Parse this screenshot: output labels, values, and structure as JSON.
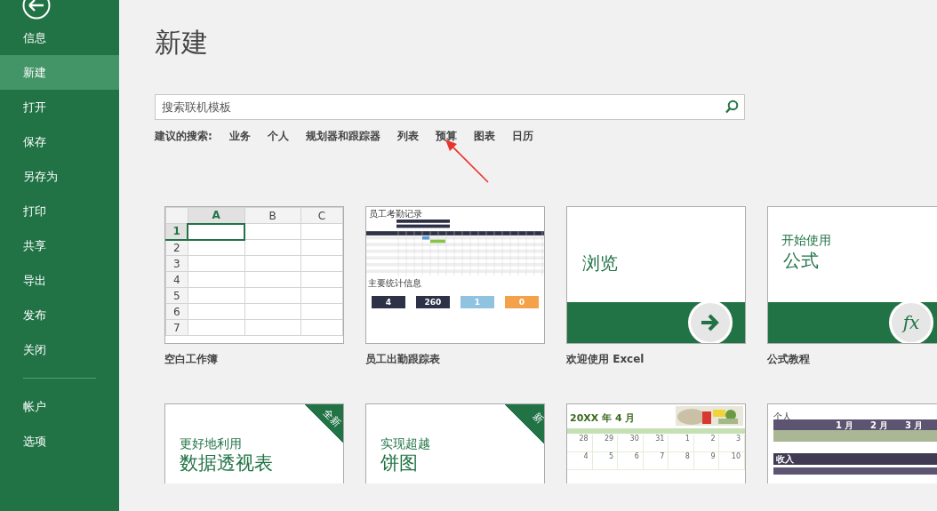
{
  "sidebar": {
    "items": [
      {
        "label": "信息",
        "selected": false
      },
      {
        "label": "新建",
        "selected": true
      },
      {
        "label": "打开",
        "selected": false
      },
      {
        "label": "保存",
        "selected": false
      },
      {
        "label": "另存为",
        "selected": false
      },
      {
        "label": "打印",
        "selected": false
      },
      {
        "label": "共享",
        "selected": false
      },
      {
        "label": "导出",
        "selected": false
      },
      {
        "label": "发布",
        "selected": false
      },
      {
        "label": "关闭",
        "selected": false
      }
    ],
    "footer_items": [
      {
        "label": "帐户",
        "selected": false
      },
      {
        "label": "选项",
        "selected": false
      }
    ]
  },
  "page_title": "新建",
  "search": {
    "placeholder": "搜索联机模板"
  },
  "suggested": {
    "label": "建议的搜索:",
    "links": [
      "业务",
      "个人",
      "规划器和跟踪器",
      "列表",
      "预算",
      "图表",
      "日历"
    ]
  },
  "templates": [
    {
      "kind": "blank_workbook",
      "caption": "空白工作簿",
      "columns": [
        "A",
        "B",
        "C"
      ],
      "rows": [
        "1",
        "2",
        "3",
        "4",
        "5",
        "6",
        "7"
      ]
    },
    {
      "kind": "attendance",
      "caption": "员工出勤跟踪表",
      "title": "员工考勤记录",
      "stats_title": "主要统计信息",
      "stats": [
        {
          "value": "4",
          "color": "#2e3247"
        },
        {
          "value": "260",
          "color": "#2e3247"
        },
        {
          "value": "1",
          "color": "#8fc3e0"
        },
        {
          "value": "0",
          "color": "#f4a24a"
        }
      ]
    },
    {
      "kind": "tour",
      "caption": "欢迎使用 Excel",
      "heading": "浏览"
    },
    {
      "kind": "tutorial",
      "caption": "公式教程",
      "subheading": "开始使用",
      "heading": "公式",
      "symbol": "fx"
    },
    {
      "kind": "featured",
      "ribbon": "全新",
      "subheading": "更好地利用",
      "heading": "数据透视表"
    },
    {
      "kind": "featured",
      "ribbon": "新",
      "subheading": "实现超越",
      "heading": "饼图"
    },
    {
      "kind": "calendar",
      "heading": "20XX 年 4 月",
      "weeks": [
        [
          "28",
          "29",
          "30",
          "31",
          "1",
          "2",
          "3"
        ],
        [
          "4",
          "5",
          "6",
          "7",
          "8",
          "9",
          "10"
        ]
      ]
    },
    {
      "kind": "budget",
      "heading": "个人",
      "months": [
        "1 月",
        "2 月",
        "3 月"
      ],
      "section": "收入"
    }
  ]
}
